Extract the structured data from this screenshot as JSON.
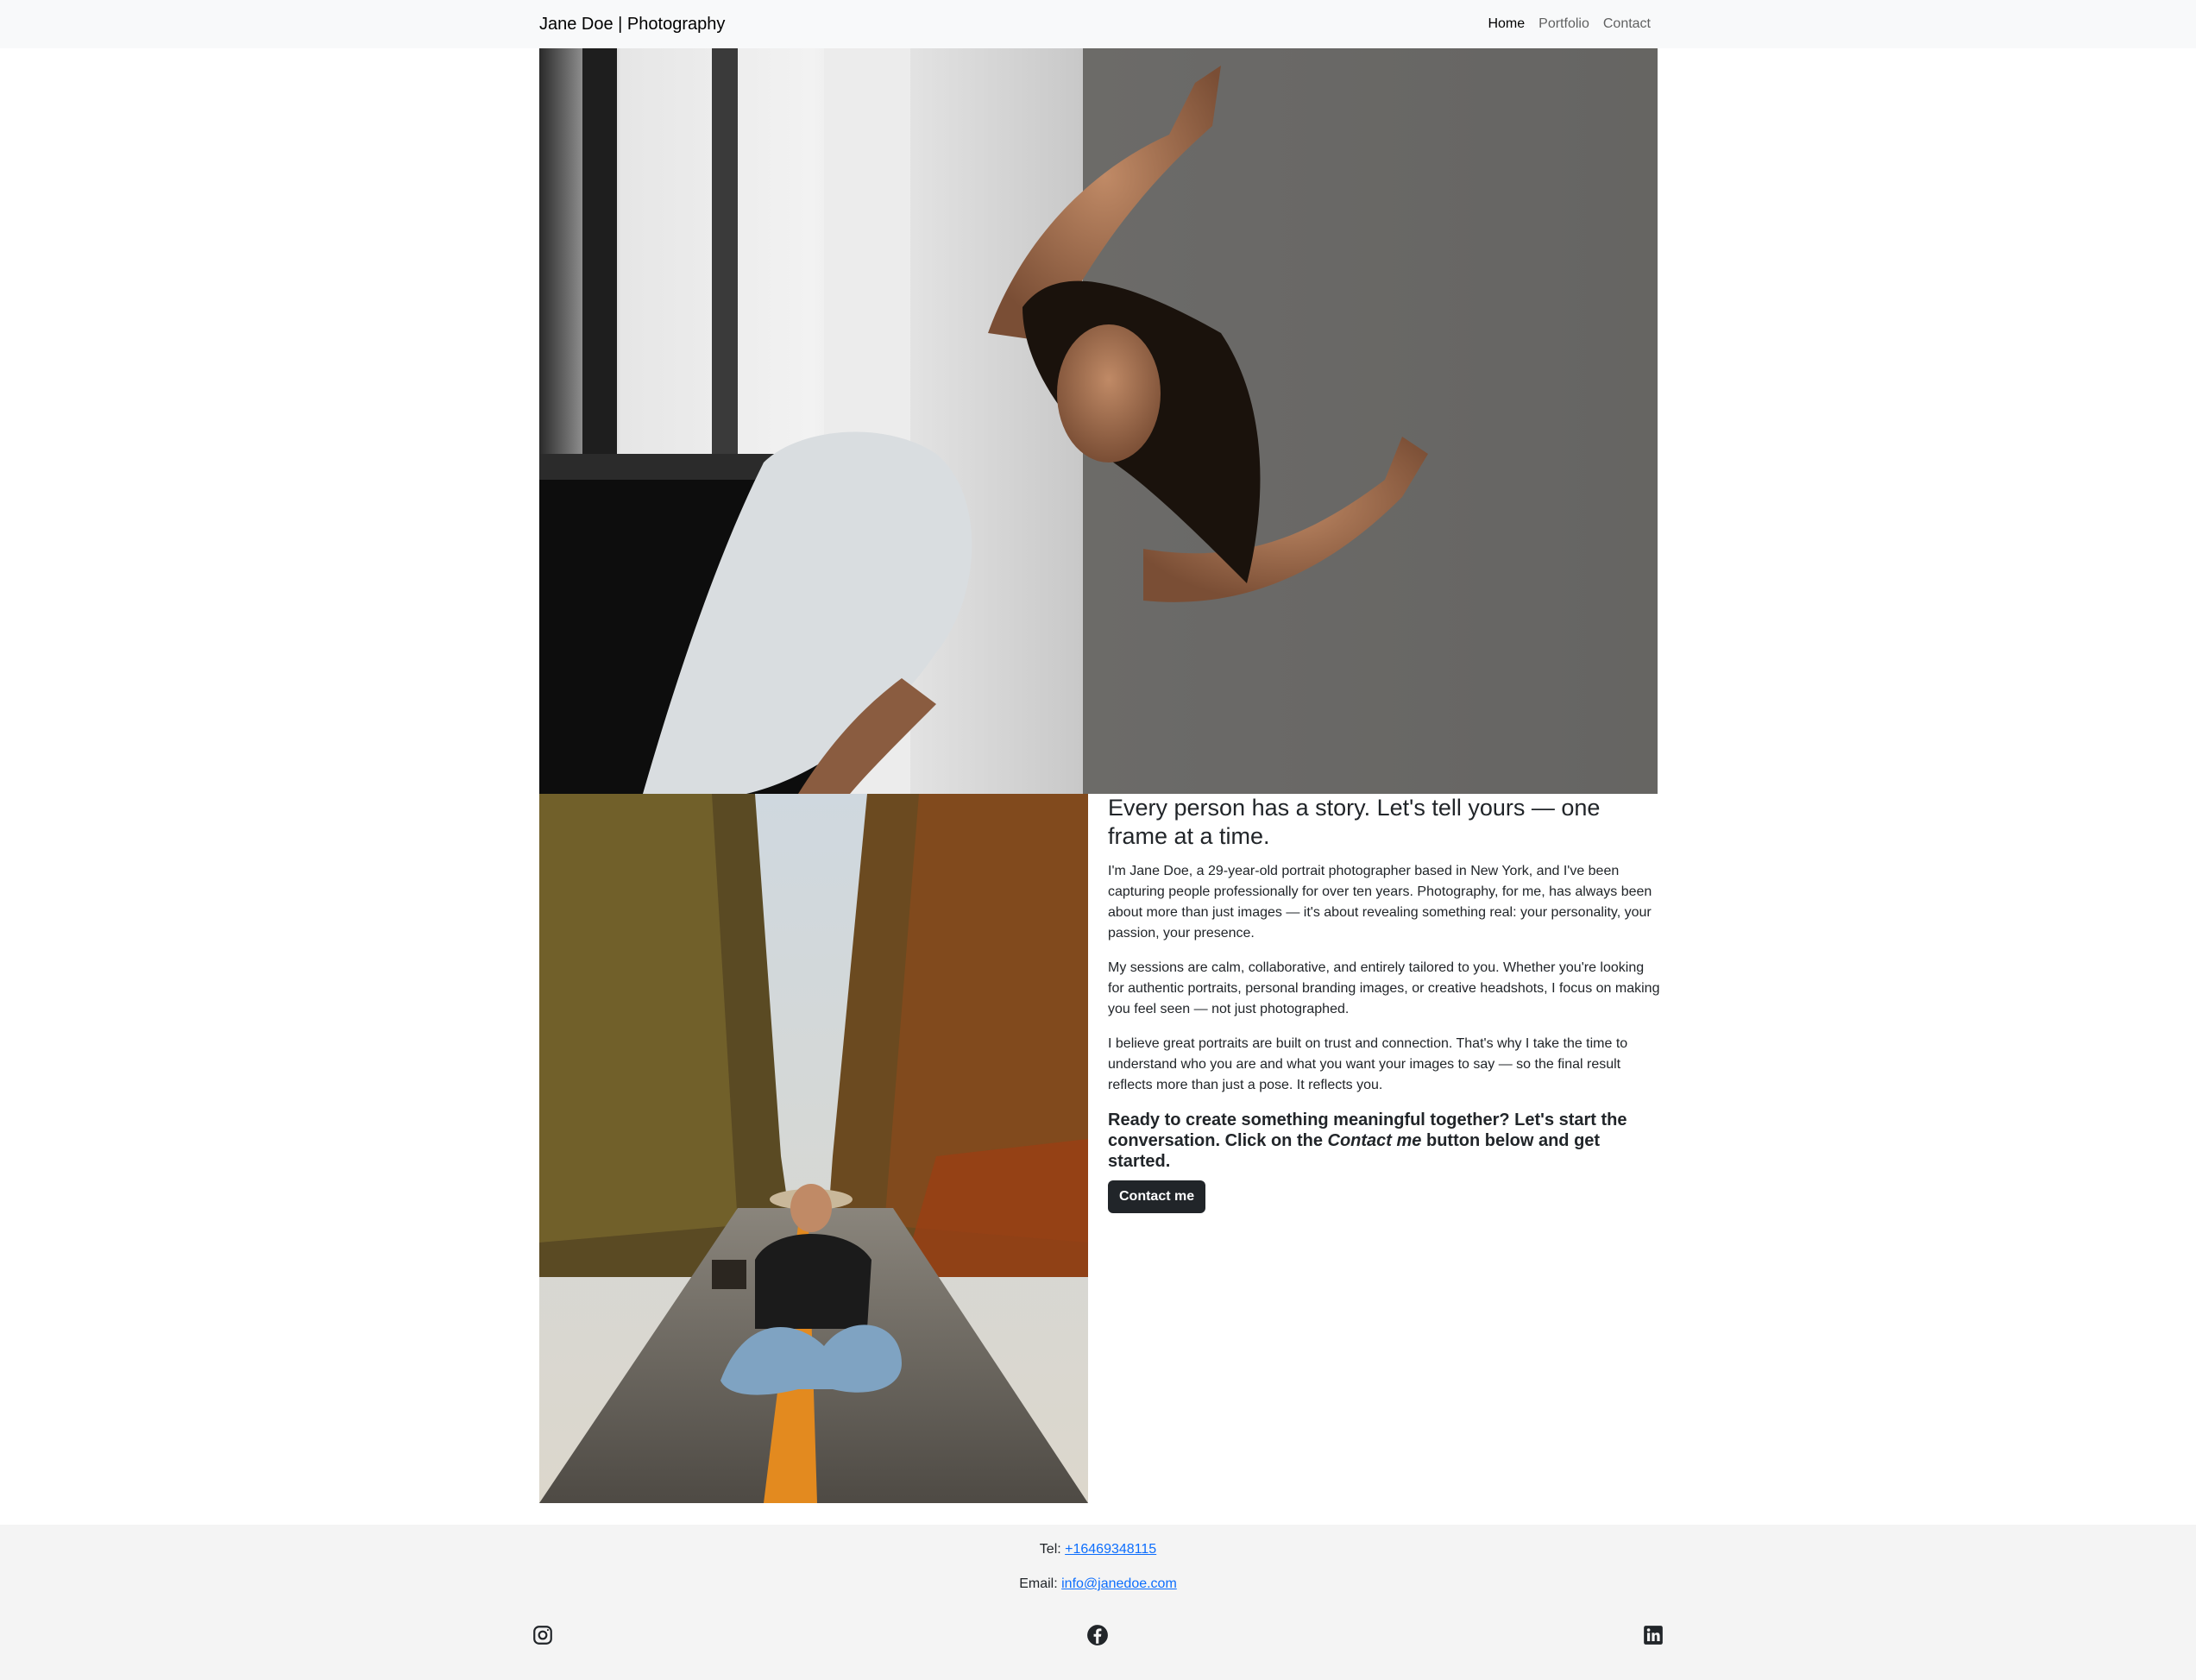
{
  "navbar": {
    "brand": "Jane Doe | Photography",
    "links": [
      {
        "label": "Home",
        "active": true
      },
      {
        "label": "Portfolio",
        "active": false
      },
      {
        "label": "Contact",
        "active": false
      }
    ]
  },
  "hero_image": {
    "icon": "dancer-photo"
  },
  "side_image": {
    "icon": "road-portrait-photo"
  },
  "about": {
    "headline": "Every person has a story. Let's tell yours — one frame at a time.",
    "paragraphs": [
      "I'm Jane Doe, a 29-year-old portrait photographer based in New York, and I've been capturing people professionally for over ten years. Photography, for me, has always been about more than just images — it's about revealing something real: your personality, your passion, your presence.",
      "My sessions are calm, collaborative, and entirely tailored to you. Whether you're looking for authentic portraits, personal branding images, or creative headshots, I focus on making you feel seen — not just photographed.",
      "I believe great portraits are built on trust and connection. That's why I take the time to understand who you are and what you want your images to say — so the final result reflects more than just a pose. It reflects you."
    ],
    "cta_before": "Ready to create something meaningful together? Let's start the conversation. Click on the ",
    "cta_em": "Contact me",
    "cta_after": " button below and get started.",
    "button_label": "Contact me"
  },
  "footer": {
    "tel_label": "Tel: ",
    "tel_value": "+16469348115",
    "email_label": "Email: ",
    "email_value": "info@janedoe.com",
    "social_icons": [
      "instagram-icon",
      "facebook-icon",
      "linkedin-icon"
    ]
  },
  "colors": {
    "navbar_bg": "#f8f9fa",
    "footer_bg": "#f4f4f4",
    "button_bg": "#212529",
    "link": "#0d6efd"
  }
}
